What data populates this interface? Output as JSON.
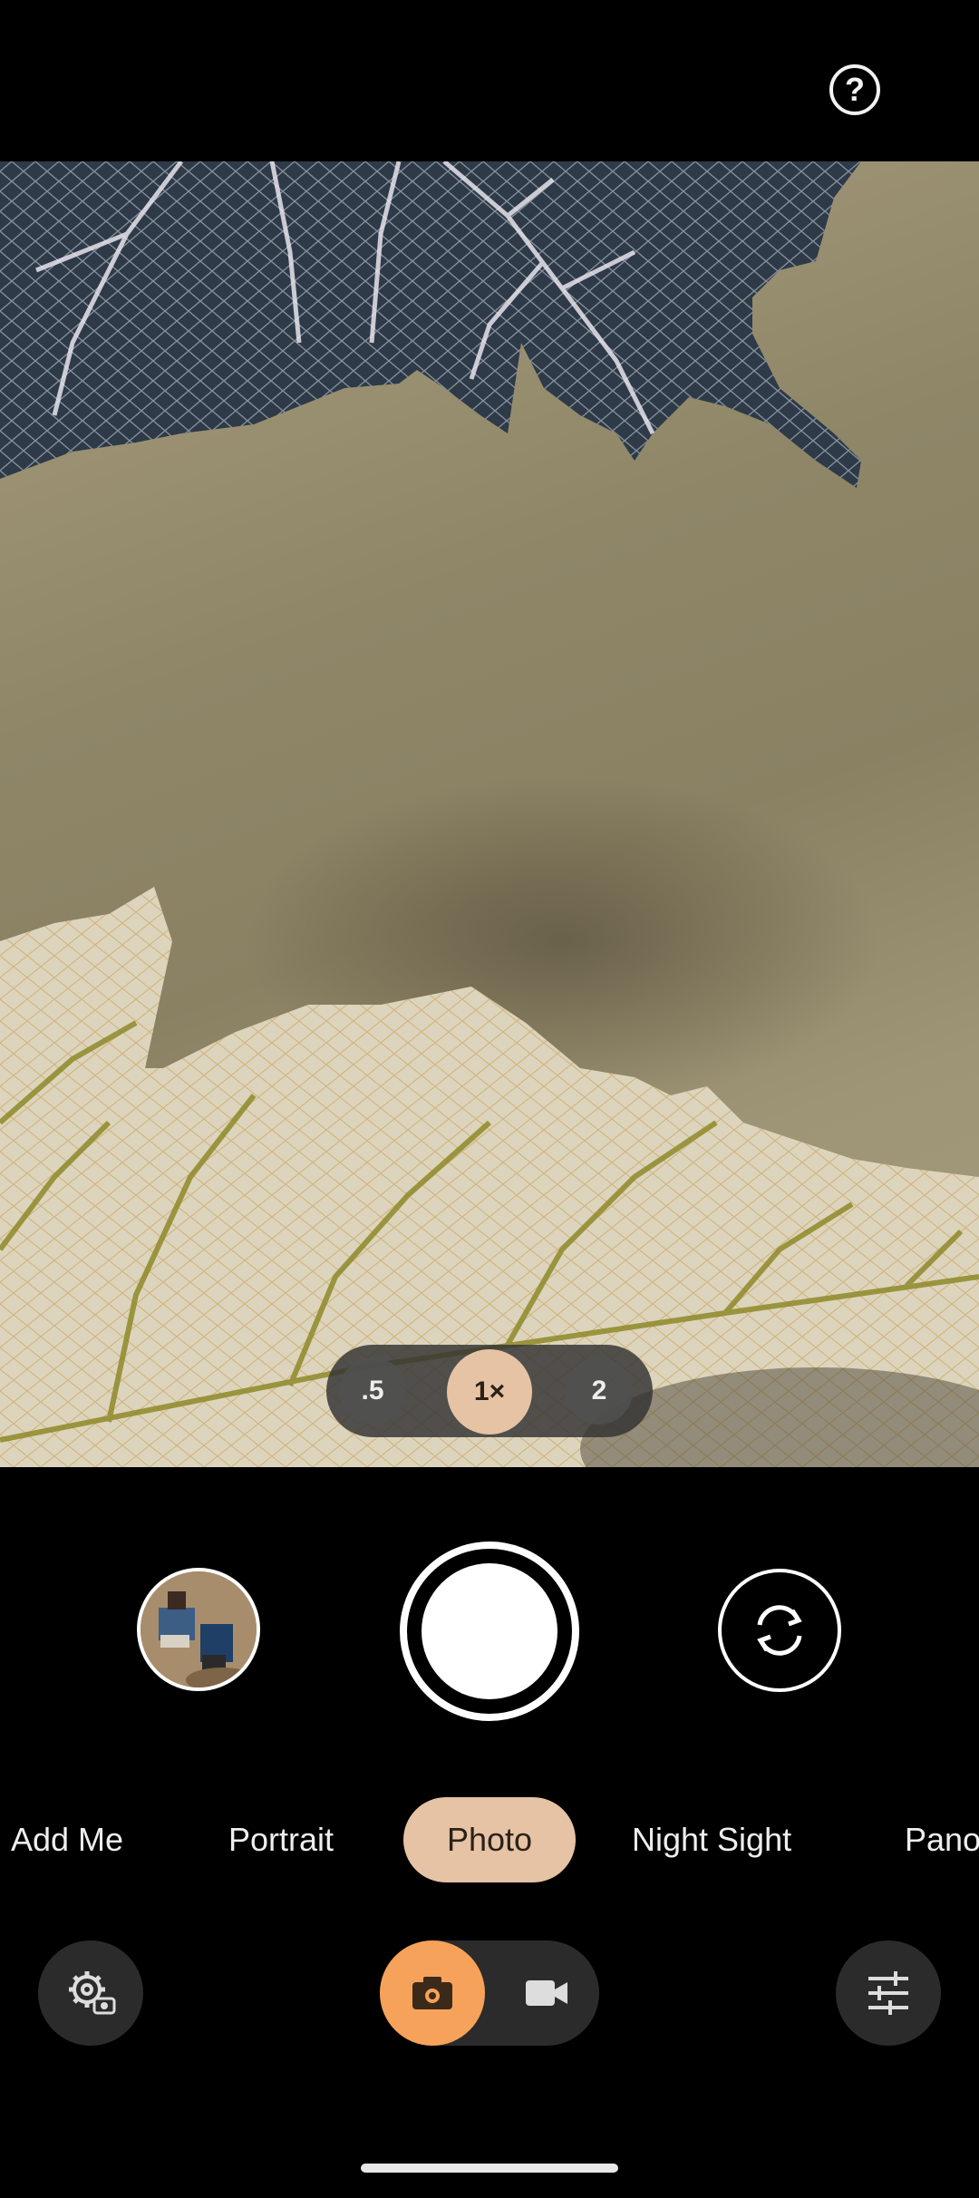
{
  "top": {
    "help_icon": "help-circle-icon",
    "help_glyph": "?"
  },
  "zoom": {
    "options": [
      ".5",
      "1×",
      "2"
    ],
    "selected": "1×"
  },
  "controls": {
    "gallery_icon": "gallery-thumbnail",
    "shutter_icon": "shutter-button",
    "flip_icon": "camera-flip-icon"
  },
  "modes": {
    "items": [
      "Add Me",
      "Portrait",
      "Photo",
      "Night Sight",
      "Pano"
    ],
    "selected": "Photo"
  },
  "bottom": {
    "settings_icon": "camera-settings-icon",
    "photo_icon": "photo-camera-icon",
    "video_icon": "video-camera-icon",
    "adjust_icon": "sliders-icon"
  },
  "colors": {
    "accent": "#e6c3a5",
    "photo_toggle": "#f7a25a",
    "background": "#000000"
  }
}
